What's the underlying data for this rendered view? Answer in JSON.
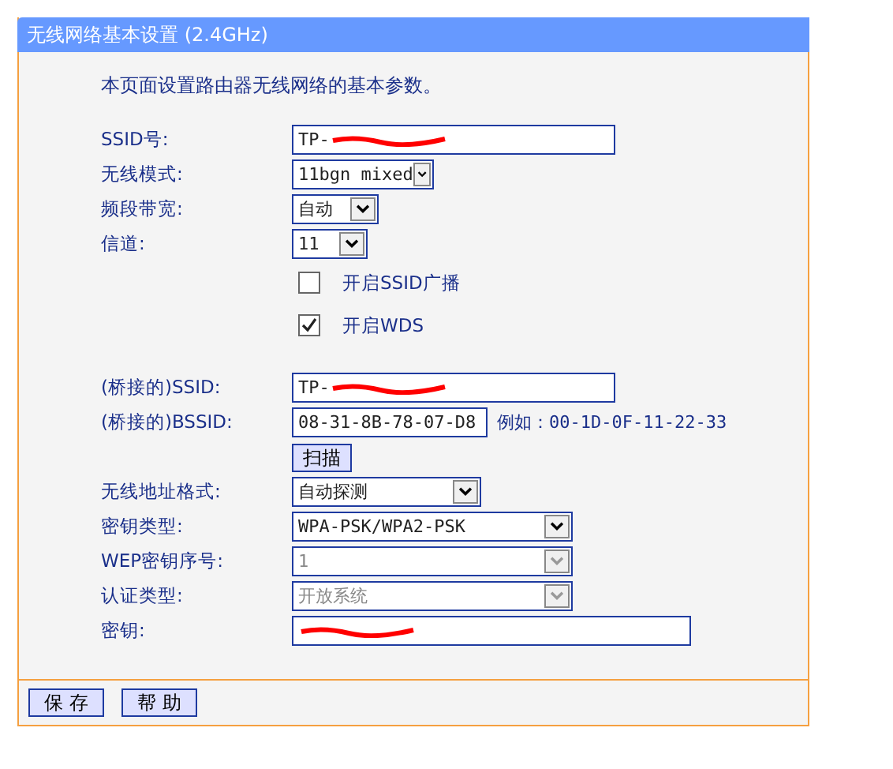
{
  "window": {
    "title": "无线网络基本设置 (2.4GHz)"
  },
  "description": "本页面设置路由器无线网络的基本参数。",
  "sections": [
    [
      {
        "kind": "text",
        "label": "SSID号:",
        "value": "TP-",
        "redacted": true
      },
      {
        "kind": "select",
        "label": "无线模式:",
        "value": "11bgn mixed",
        "disabled": false
      },
      {
        "kind": "select",
        "label": "频段带宽:",
        "value": "自动",
        "disabled": false
      },
      {
        "kind": "select",
        "label": "信道:",
        "value": "11",
        "disabled": false
      },
      {
        "kind": "checkbox",
        "text": "开启SSID广播",
        "checked": false
      },
      {
        "kind": "checkbox",
        "text": "开启WDS",
        "checked": true
      }
    ],
    [
      {
        "kind": "text",
        "label": "(桥接的)SSID:",
        "value": "TP-",
        "redacted": true
      },
      {
        "kind": "text",
        "label": "(桥接的)BSSID:",
        "value": "08-31-8B-78-07-D8",
        "redacted": false,
        "hint": "例如：00-1D-0F-11-22-33"
      },
      {
        "kind": "button",
        "text": "扫描"
      },
      {
        "kind": "select",
        "label": "无线地址格式:",
        "value": "自动探测",
        "disabled": false
      },
      {
        "kind": "select",
        "label": "密钥类型:",
        "value": "WPA-PSK/WPA2-PSK",
        "disabled": false
      },
      {
        "kind": "select",
        "label": "WEP密钥序号:",
        "value": "1",
        "disabled": true
      },
      {
        "kind": "select",
        "label": "认证类型:",
        "value": "开放系统",
        "disabled": true
      },
      {
        "kind": "text",
        "label": "密钥:",
        "redacted": true
      }
    ]
  ],
  "buttons": [
    "保 存",
    "帮 助"
  ]
}
